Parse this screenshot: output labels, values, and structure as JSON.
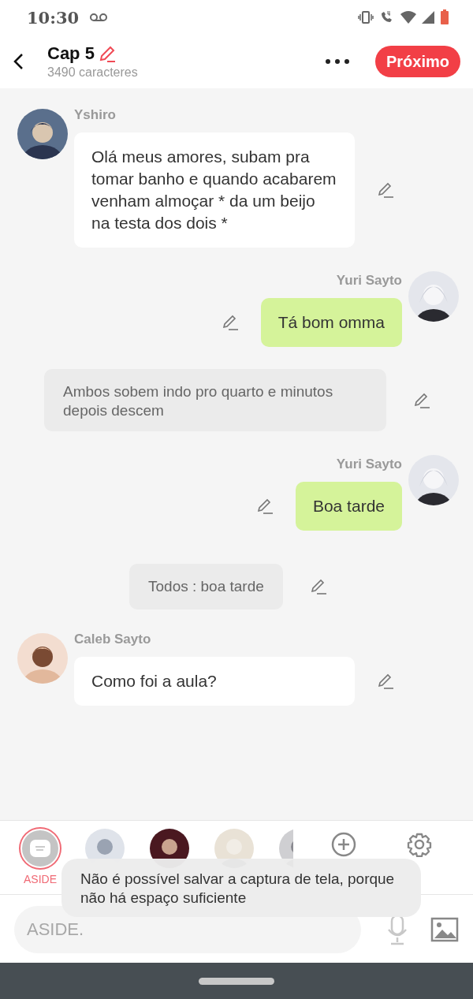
{
  "status_bar": {
    "time": "10:30"
  },
  "header": {
    "title": "Cap 5",
    "subtitle": "3490 caracteres",
    "next_button": "Próximo"
  },
  "messages": [
    {
      "kind": "left",
      "name": "Yshiro",
      "text": "Olá meus amores, subam pra tomar banho e quando acabarem venham almoçar * da um beijo na testa dos dois *"
    },
    {
      "kind": "right",
      "name": "Yuri Sayto",
      "text": "Tá bom omma"
    },
    {
      "kind": "narration",
      "text": "Ambos sobem indo pro quarto e minutos depois descem"
    },
    {
      "kind": "right",
      "name": "Yuri Sayto",
      "text": "Boa tarde"
    },
    {
      "kind": "narration",
      "text": "Todos : boa tarde"
    },
    {
      "kind": "left",
      "name": "Caleb Sayto",
      "text": "Como foi a aula?"
    }
  ],
  "character_bar": [
    {
      "kind": "aside",
      "label": "ASIDE",
      "selected": true
    },
    {
      "kind": "character",
      "selected": false
    },
    {
      "kind": "character",
      "selected": false
    },
    {
      "kind": "character",
      "selected": false
    },
    {
      "kind": "character",
      "selected": false
    },
    {
      "kind": "add"
    },
    {
      "kind": "settings"
    }
  ],
  "input": {
    "placeholder": "ASIDE."
  },
  "toast": {
    "text": "Não é possível salvar a captura de tela, porque não há espaço suficiente"
  }
}
